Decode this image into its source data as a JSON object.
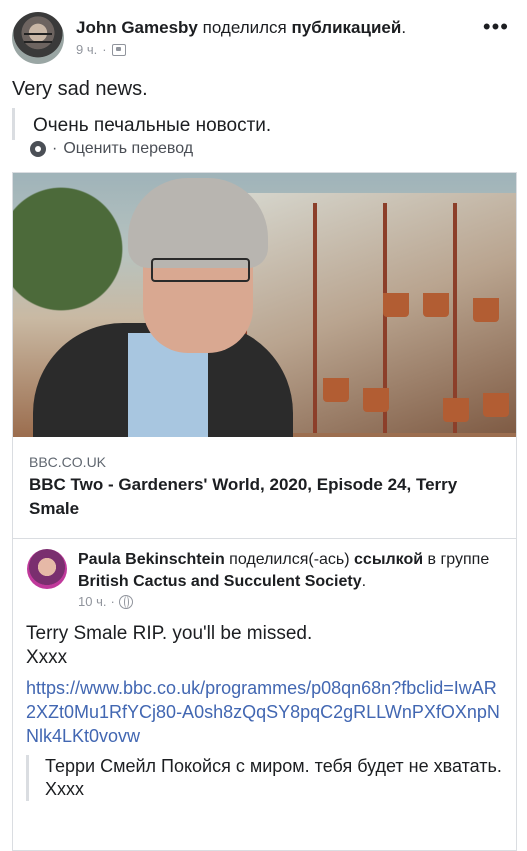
{
  "post": {
    "author": "John Gamesby",
    "verb": "поделился",
    "object": "публикацией",
    "period": ".",
    "time": "9 ч.",
    "separator": "·",
    "more_label": "•••",
    "text": "Very sad news.",
    "translation": "Очень печальные новости.",
    "rate_separator": "·",
    "rate_label": "Оценить перевод"
  },
  "link_card": {
    "domain": "BBC.CO.UK",
    "title": "BBC Two - Gardeners' World, 2020, Episode 24, Terry Smale"
  },
  "shared_post": {
    "author": "Paula Bekinschtein",
    "verb": "поделился(-ась)",
    "object": "ссылкой",
    "in_group": "в группе",
    "group": "British Cactus and Succulent Society",
    "period": ".",
    "time": "10 ч.",
    "separator": "·",
    "text": "Terry Smale RIP. you'll be missed.\nXxxx",
    "link": "https://www.bbc.co.uk/programmes/p08qn68n?fbclid=IwAR2XZt0Mu1RfYCj80-A0sh8zQqSY8pqC2gRLLWnPXfOXnpNNlk4LKt0vovw",
    "translation": "Терри Смейл Покойся с миром. тебя будет не хватать.\nXxxx"
  },
  "icons": {
    "audience": "audience-icon",
    "gear": "gear-icon",
    "globe": "globe-icon",
    "more": "more-options-icon"
  }
}
